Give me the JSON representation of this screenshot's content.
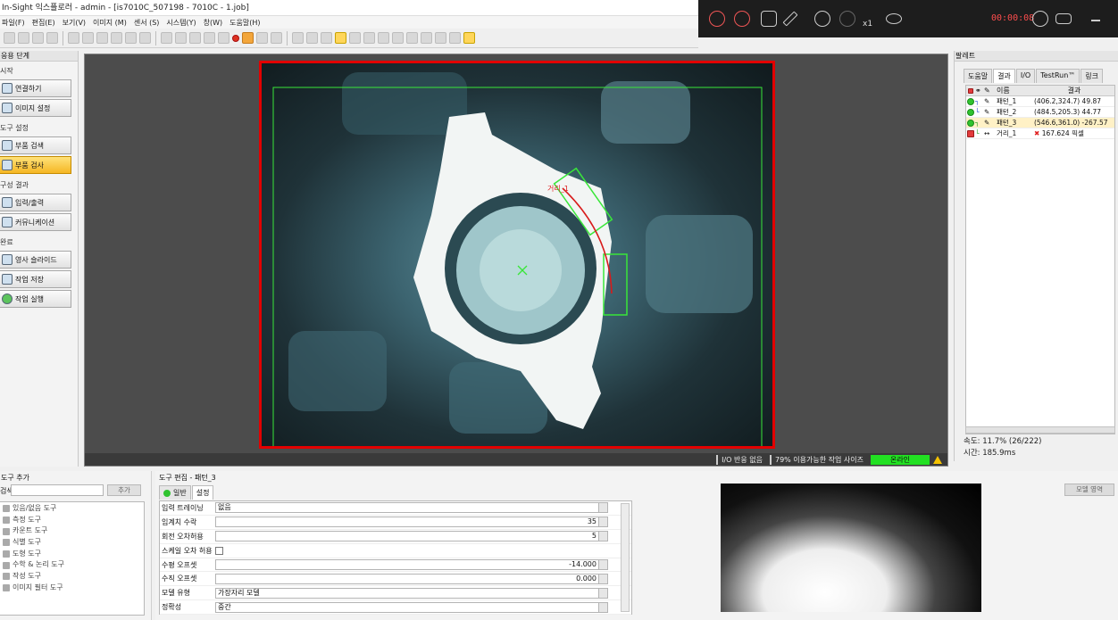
{
  "window": {
    "title": "In-Sight 익스플로러 - admin - [is7010C_507198 - 7010C - 1.job]"
  },
  "menu": [
    "파일(F)",
    "편집(E)",
    "보기(V)",
    "이미지 (M)",
    "센서 (S)",
    "시스템(Y)",
    "창(W)",
    "도움말(H)"
  ],
  "recorder": {
    "time": "00:00:08",
    "zoom_label": "x1"
  },
  "left_panel": {
    "header": "응용 단계",
    "sections": [
      {
        "title": "시작",
        "buttons": [
          "연결하기",
          "이미지 설정"
        ]
      },
      {
        "title": "도구 설정",
        "buttons": [
          "부품 검색",
          "부품 검사"
        ]
      },
      {
        "title": "구성 결과",
        "buttons": [
          "입력/출력",
          "커뮤니케이션"
        ]
      },
      {
        "title": "완료",
        "buttons": [
          "영사 슬라이드",
          "작업 저장",
          "작업 실행"
        ]
      }
    ],
    "active_button": "부품 검사"
  },
  "image_view": {
    "status": {
      "io_response": "I/O 반응 없음",
      "job_size": "79% 이용가능한 작업 사이즈",
      "online": "온라인"
    },
    "overlay_label": "거리_1"
  },
  "palette": {
    "title": "팔레트",
    "tabs": [
      "도움말",
      "결과",
      "I/O",
      "TestRun™",
      "링크"
    ],
    "active_tab": "결과",
    "columns": {
      "name": "이름",
      "result": "결과"
    },
    "rows": [
      {
        "name": "패턴_1",
        "result": "(406.2,324.7) 49.87",
        "status": "pass"
      },
      {
        "name": "패턴_2",
        "result": "(484.5,205.3) 44.77",
        "status": "pass"
      },
      {
        "name": "패턴_3",
        "result": "(546.6,361.0) -267.57",
        "status": "pass"
      },
      {
        "name": "거리_1",
        "result": "167.624 픽셀",
        "status": "fail"
      }
    ],
    "speed": "속도: 11.7% (26/222)",
    "time": "시간: 185.9ms"
  },
  "add_tool": {
    "title": "도구 추가",
    "search_label": "검색:",
    "add_button": "추가",
    "items": [
      "있음/없음 도구",
      "측정 도구",
      "카운트 도구",
      "식별 도구",
      "도형 도구",
      "수학 & 논리 도구",
      "작성 도구",
      "이미지 필터 도구"
    ]
  },
  "edit_tool": {
    "title": "도구 편집 - 패턴_3",
    "tabs": [
      "일반",
      "설정"
    ],
    "active_tab": "설정",
    "settings": [
      {
        "label": "입력 트레이닝",
        "value": "없음",
        "type": "select"
      },
      {
        "label": "임계치 수락",
        "value": "35",
        "type": "number"
      },
      {
        "label": "회전 오차허용",
        "value": "5",
        "type": "number"
      },
      {
        "label": "스케일 오차 허용",
        "value": "",
        "type": "checkbox"
      },
      {
        "label": "수평 오프셋",
        "value": "-14.000",
        "type": "number"
      },
      {
        "label": "수직 오프셋",
        "value": "0.000",
        "type": "number"
      },
      {
        "label": "모델 유형",
        "value": "가장자리 모델",
        "type": "select"
      },
      {
        "label": "정확성",
        "value": "중간",
        "type": "select"
      }
    ]
  },
  "model_panel": {
    "button": "모델 영역"
  }
}
